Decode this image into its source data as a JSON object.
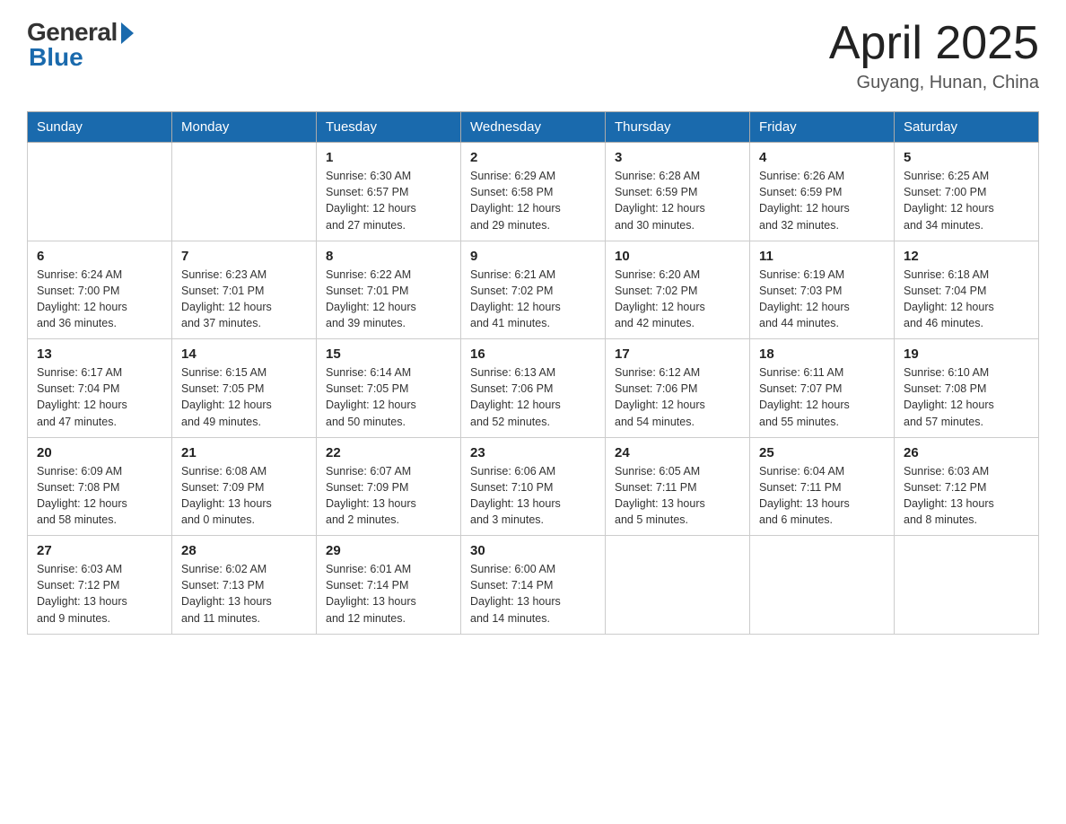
{
  "logo": {
    "general": "General",
    "blue": "Blue"
  },
  "title": {
    "month_year": "April 2025",
    "location": "Guyang, Hunan, China"
  },
  "days_of_week": [
    "Sunday",
    "Monday",
    "Tuesday",
    "Wednesday",
    "Thursday",
    "Friday",
    "Saturday"
  ],
  "weeks": [
    [
      {
        "day": "",
        "info": ""
      },
      {
        "day": "",
        "info": ""
      },
      {
        "day": "1",
        "info": "Sunrise: 6:30 AM\nSunset: 6:57 PM\nDaylight: 12 hours\nand 27 minutes."
      },
      {
        "day": "2",
        "info": "Sunrise: 6:29 AM\nSunset: 6:58 PM\nDaylight: 12 hours\nand 29 minutes."
      },
      {
        "day": "3",
        "info": "Sunrise: 6:28 AM\nSunset: 6:59 PM\nDaylight: 12 hours\nand 30 minutes."
      },
      {
        "day": "4",
        "info": "Sunrise: 6:26 AM\nSunset: 6:59 PM\nDaylight: 12 hours\nand 32 minutes."
      },
      {
        "day": "5",
        "info": "Sunrise: 6:25 AM\nSunset: 7:00 PM\nDaylight: 12 hours\nand 34 minutes."
      }
    ],
    [
      {
        "day": "6",
        "info": "Sunrise: 6:24 AM\nSunset: 7:00 PM\nDaylight: 12 hours\nand 36 minutes."
      },
      {
        "day": "7",
        "info": "Sunrise: 6:23 AM\nSunset: 7:01 PM\nDaylight: 12 hours\nand 37 minutes."
      },
      {
        "day": "8",
        "info": "Sunrise: 6:22 AM\nSunset: 7:01 PM\nDaylight: 12 hours\nand 39 minutes."
      },
      {
        "day": "9",
        "info": "Sunrise: 6:21 AM\nSunset: 7:02 PM\nDaylight: 12 hours\nand 41 minutes."
      },
      {
        "day": "10",
        "info": "Sunrise: 6:20 AM\nSunset: 7:02 PM\nDaylight: 12 hours\nand 42 minutes."
      },
      {
        "day": "11",
        "info": "Sunrise: 6:19 AM\nSunset: 7:03 PM\nDaylight: 12 hours\nand 44 minutes."
      },
      {
        "day": "12",
        "info": "Sunrise: 6:18 AM\nSunset: 7:04 PM\nDaylight: 12 hours\nand 46 minutes."
      }
    ],
    [
      {
        "day": "13",
        "info": "Sunrise: 6:17 AM\nSunset: 7:04 PM\nDaylight: 12 hours\nand 47 minutes."
      },
      {
        "day": "14",
        "info": "Sunrise: 6:15 AM\nSunset: 7:05 PM\nDaylight: 12 hours\nand 49 minutes."
      },
      {
        "day": "15",
        "info": "Sunrise: 6:14 AM\nSunset: 7:05 PM\nDaylight: 12 hours\nand 50 minutes."
      },
      {
        "day": "16",
        "info": "Sunrise: 6:13 AM\nSunset: 7:06 PM\nDaylight: 12 hours\nand 52 minutes."
      },
      {
        "day": "17",
        "info": "Sunrise: 6:12 AM\nSunset: 7:06 PM\nDaylight: 12 hours\nand 54 minutes."
      },
      {
        "day": "18",
        "info": "Sunrise: 6:11 AM\nSunset: 7:07 PM\nDaylight: 12 hours\nand 55 minutes."
      },
      {
        "day": "19",
        "info": "Sunrise: 6:10 AM\nSunset: 7:08 PM\nDaylight: 12 hours\nand 57 minutes."
      }
    ],
    [
      {
        "day": "20",
        "info": "Sunrise: 6:09 AM\nSunset: 7:08 PM\nDaylight: 12 hours\nand 58 minutes."
      },
      {
        "day": "21",
        "info": "Sunrise: 6:08 AM\nSunset: 7:09 PM\nDaylight: 13 hours\nand 0 minutes."
      },
      {
        "day": "22",
        "info": "Sunrise: 6:07 AM\nSunset: 7:09 PM\nDaylight: 13 hours\nand 2 minutes."
      },
      {
        "day": "23",
        "info": "Sunrise: 6:06 AM\nSunset: 7:10 PM\nDaylight: 13 hours\nand 3 minutes."
      },
      {
        "day": "24",
        "info": "Sunrise: 6:05 AM\nSunset: 7:11 PM\nDaylight: 13 hours\nand 5 minutes."
      },
      {
        "day": "25",
        "info": "Sunrise: 6:04 AM\nSunset: 7:11 PM\nDaylight: 13 hours\nand 6 minutes."
      },
      {
        "day": "26",
        "info": "Sunrise: 6:03 AM\nSunset: 7:12 PM\nDaylight: 13 hours\nand 8 minutes."
      }
    ],
    [
      {
        "day": "27",
        "info": "Sunrise: 6:03 AM\nSunset: 7:12 PM\nDaylight: 13 hours\nand 9 minutes."
      },
      {
        "day": "28",
        "info": "Sunrise: 6:02 AM\nSunset: 7:13 PM\nDaylight: 13 hours\nand 11 minutes."
      },
      {
        "day": "29",
        "info": "Sunrise: 6:01 AM\nSunset: 7:14 PM\nDaylight: 13 hours\nand 12 minutes."
      },
      {
        "day": "30",
        "info": "Sunrise: 6:00 AM\nSunset: 7:14 PM\nDaylight: 13 hours\nand 14 minutes."
      },
      {
        "day": "",
        "info": ""
      },
      {
        "day": "",
        "info": ""
      },
      {
        "day": "",
        "info": ""
      }
    ]
  ]
}
